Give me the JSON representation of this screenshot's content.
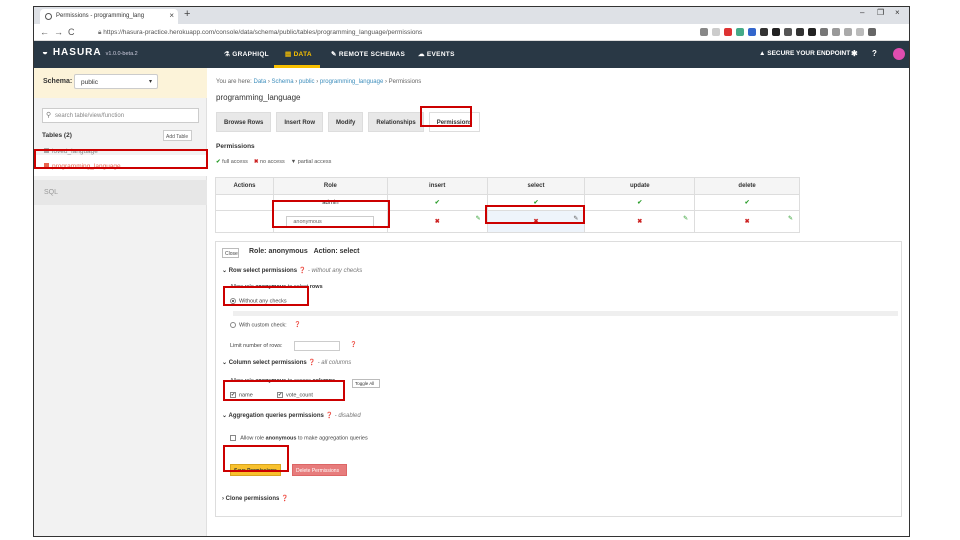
{
  "browser": {
    "tab_title": "Permissions - programming_lang",
    "tab_close": "×",
    "new_tab": "+",
    "url": "https://hasura-practice.herokuapp.com/console/data/schema/public/tables/programming_language/permissions",
    "win_minimize": "–",
    "win_restore": "❐",
    "win_close": "×"
  },
  "header": {
    "logo": "HASURA",
    "version": "v1.0.0-beta.2",
    "nav": [
      "GRAPHIQL",
      "DATA",
      "REMOTE SCHEMAS",
      "EVENTS"
    ],
    "secure": "SECURE YOUR ENDPOINT",
    "help": "?"
  },
  "sidebar": {
    "schema_label": "Schema:",
    "schema_value": "public",
    "search_placeholder": "search table/view/function",
    "tables_header": "Tables (2)",
    "add_table": "Add Table",
    "tables": [
      "loved_language",
      "programming_language"
    ],
    "sql": "SQL"
  },
  "main": {
    "breadcrumb": {
      "prefix": "You are here:",
      "items": [
        "Data",
        "Schema",
        "public",
        "programming_language",
        "Permissions"
      ]
    },
    "title": "programming_language",
    "tabs": [
      "Browse Rows",
      "Insert Row",
      "Modify",
      "Relationships",
      "Permissions"
    ],
    "permissions_label": "Permissions",
    "legend": {
      "full": "full access",
      "none": "no access",
      "partial": "partial access"
    },
    "table": {
      "headers": [
        "Actions",
        "Role",
        "insert",
        "select",
        "update",
        "delete"
      ],
      "admin_role": "admin",
      "anon_placeholder": "anonymous"
    },
    "editor": {
      "close": "Close",
      "role_line": "Role: anonymous",
      "action_line": "Action: select",
      "row_perm": "Row select permissions",
      "row_hint": "- without any checks",
      "allow_role_prefix": "Allow role",
      "role_name": "anonymous",
      "to_select": "to select",
      "rows": "rows",
      "without_checks": "Without any checks",
      "with_custom": "With custom check:",
      "limit_rows": "Limit number of rows:",
      "col_perm": "Column select permissions",
      "col_hint": "- all columns",
      "to_access": "to access",
      "columns": "columns",
      "toggle_all": "Toggle All",
      "col_name": "name",
      "col_vote": "vote_count",
      "agg_perm": "Aggregation queries permissions",
      "agg_hint": "- disabled",
      "agg_allow": "to make aggregation queries",
      "save": "Save Permissions",
      "delete": "Delete Permissions",
      "clone": "Clone permissions"
    }
  }
}
